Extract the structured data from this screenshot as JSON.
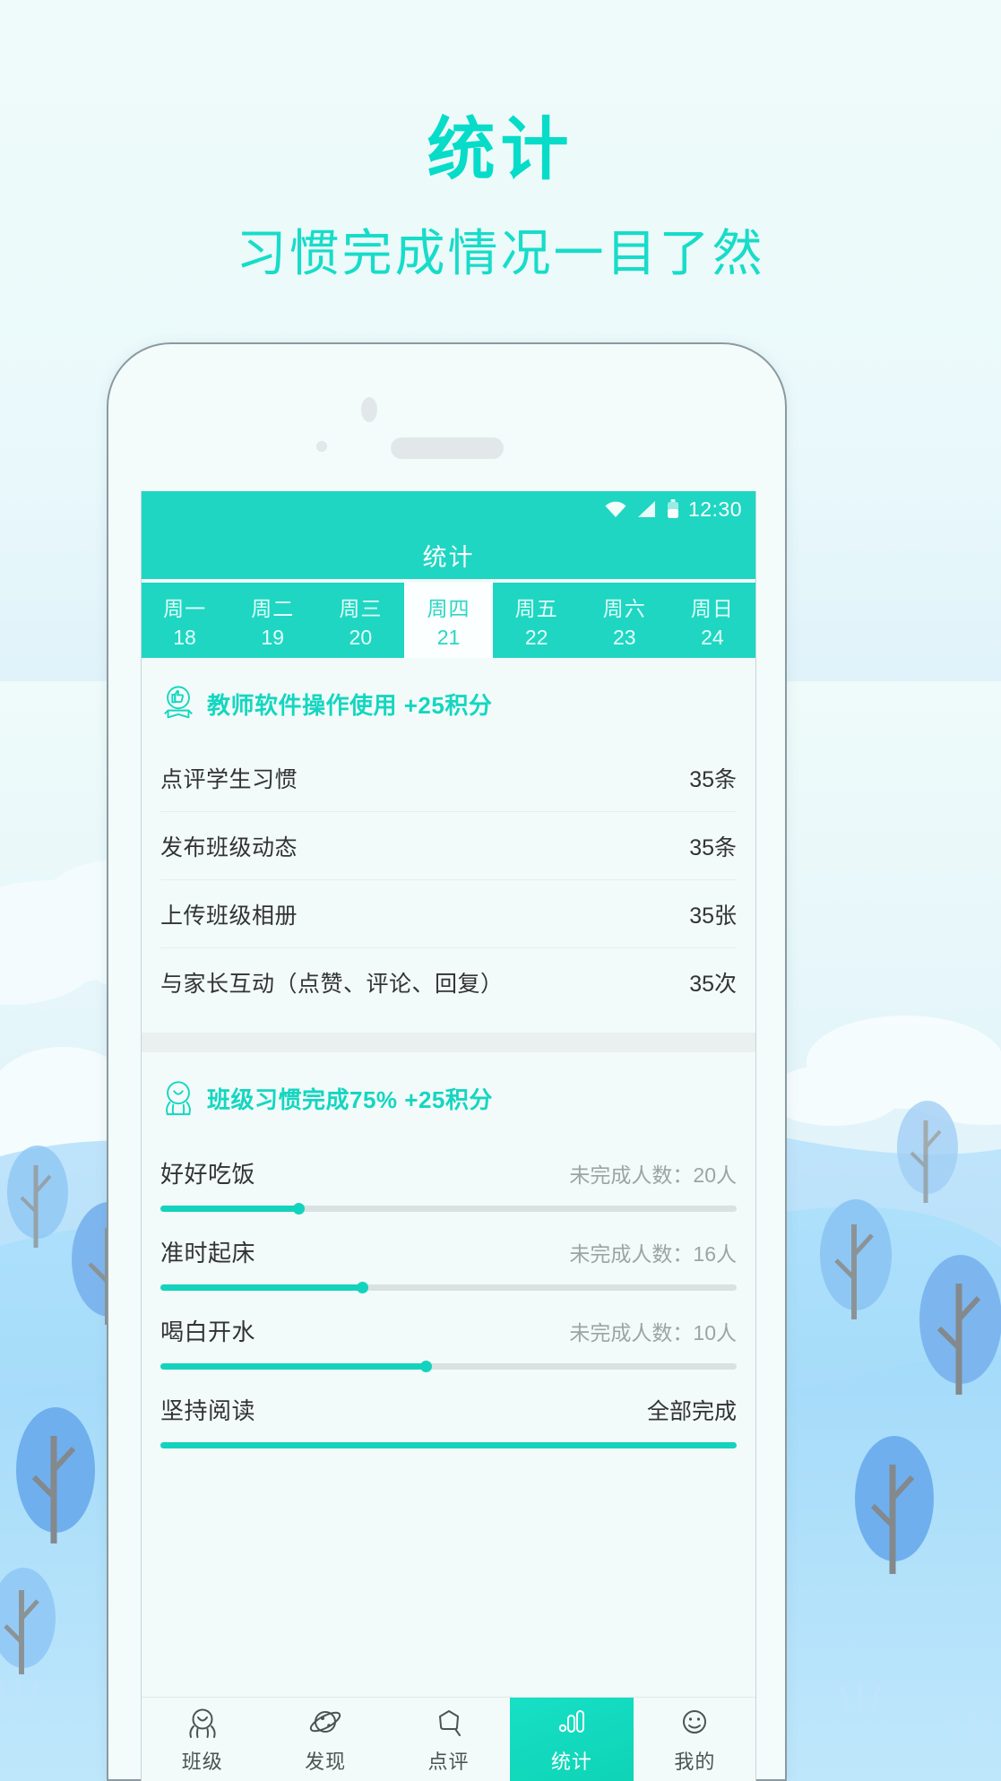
{
  "promo": {
    "title": "统计",
    "subtitle": "习惯完成情况一目了然",
    "accent_color": "#07dcc9"
  },
  "statusbar": {
    "time": "12:30",
    "wifi_icon": "wifi-icon",
    "signal_icon": "signal-icon",
    "battery_icon": "battery-icon"
  },
  "appbar": {
    "title": "统计",
    "background_color": "#1fd6c2"
  },
  "daytabs": {
    "selected_index": 3,
    "days": [
      {
        "name": "周一",
        "date": "18"
      },
      {
        "name": "周二",
        "date": "19"
      },
      {
        "name": "周三",
        "date": "20"
      },
      {
        "name": "周四",
        "date": "21"
      },
      {
        "name": "周五",
        "date": "22"
      },
      {
        "name": "周六",
        "date": "23"
      },
      {
        "name": "周日",
        "date": "24"
      }
    ]
  },
  "section_teacher": {
    "icon": "medal-thumbsup-icon",
    "title": "教师软件操作使用 +25积分",
    "rows": [
      {
        "label": "点评学生习惯",
        "value": "35条"
      },
      {
        "label": "发布班级动态",
        "value": "35条"
      },
      {
        "label": "上传班级相册",
        "value": "35张"
      },
      {
        "label": "与家长互动（点赞、评论、回复）",
        "value": "35次"
      }
    ]
  },
  "section_class": {
    "icon": "medal-person-icon",
    "title": "班级习惯完成75% +25积分",
    "habits": [
      {
        "name": "好好吃饭",
        "meta": "未完成人数：20人",
        "percent": 24,
        "done": false
      },
      {
        "name": "准时起床",
        "meta": "未完成人数：16人",
        "percent": 35,
        "done": false
      },
      {
        "name": "喝白开水",
        "meta": "未完成人数：10人",
        "percent": 46,
        "done": false
      },
      {
        "name": "坚持阅读",
        "meta": "全部完成",
        "percent": 100,
        "done": true
      }
    ]
  },
  "bottomnav": {
    "active_index": 3,
    "active_color": "#12d9c0",
    "items": [
      {
        "label": "班级",
        "icon": "class-octopus-icon"
      },
      {
        "label": "发现",
        "icon": "planet-icon"
      },
      {
        "label": "点评",
        "icon": "star-comment-icon"
      },
      {
        "label": "统计",
        "icon": "bar-chart-icon"
      },
      {
        "label": "我的",
        "icon": "smiley-face-icon"
      }
    ]
  }
}
